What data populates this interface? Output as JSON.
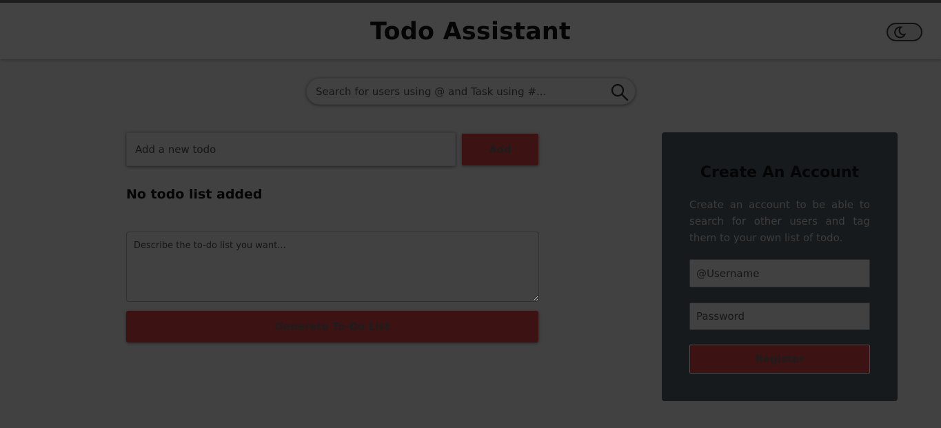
{
  "header": {
    "title": "Todo Assistant",
    "theme_toggle_icon": "moon-icon"
  },
  "search": {
    "placeholder": "Search for users using @ and Task using #...",
    "icon": "search-icon"
  },
  "todo": {
    "input_placeholder": "Add a new todo",
    "add_label": "Add",
    "empty_message": "No todo list added"
  },
  "generator": {
    "placeholder": "Describe the to-do list you want...",
    "button_label": "Generate To-Do List"
  },
  "account": {
    "title": "Create An Account",
    "description": "Create an account to be able to search for other users and tag them to your own list of todo.",
    "username_placeholder": "@Username",
    "password_placeholder": "Password",
    "register_label": "Register"
  },
  "colors": {
    "background": "#414141",
    "accent": "#3c1213",
    "card": "#171a1d"
  }
}
